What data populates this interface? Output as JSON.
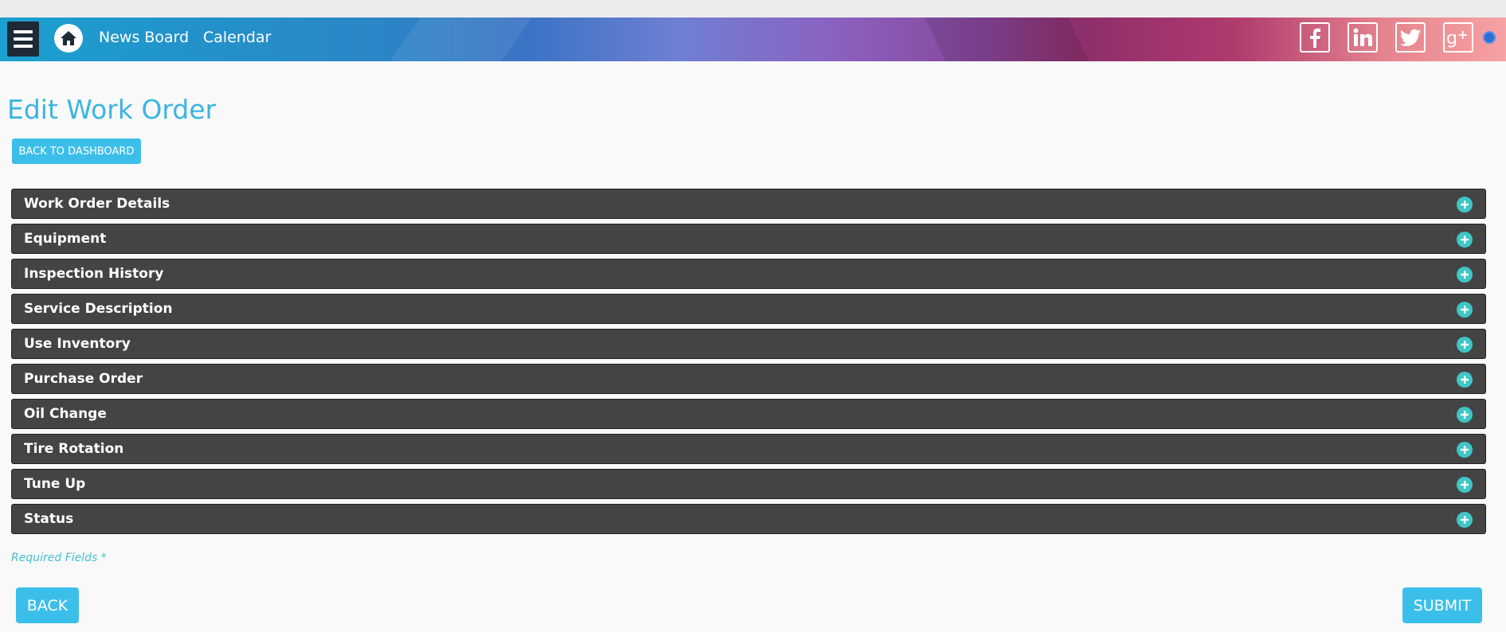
{
  "nav": {
    "links": [
      "News Board",
      "Calendar"
    ],
    "social": [
      "facebook-icon",
      "linkedin-icon",
      "twitter-icon",
      "google-plus-icon"
    ]
  },
  "page": {
    "title": "Edit Work Order",
    "back_to_dashboard": "BACK TO DASHBOARD"
  },
  "sections": [
    "Work Order Details",
    "Equipment",
    "Inspection History",
    "Service Description",
    "Use Inventory",
    "Purchase Order",
    "Oil Change",
    "Tire Rotation",
    "Tune Up",
    "Status"
  ],
  "footer": {
    "required_note": "Required Fields *",
    "back_label": "BACK",
    "submit_label": "SUBMIT"
  },
  "colors": {
    "accent": "#3bbfea",
    "section_bg": "#444444",
    "plus_icon": "#3fc6c6"
  }
}
